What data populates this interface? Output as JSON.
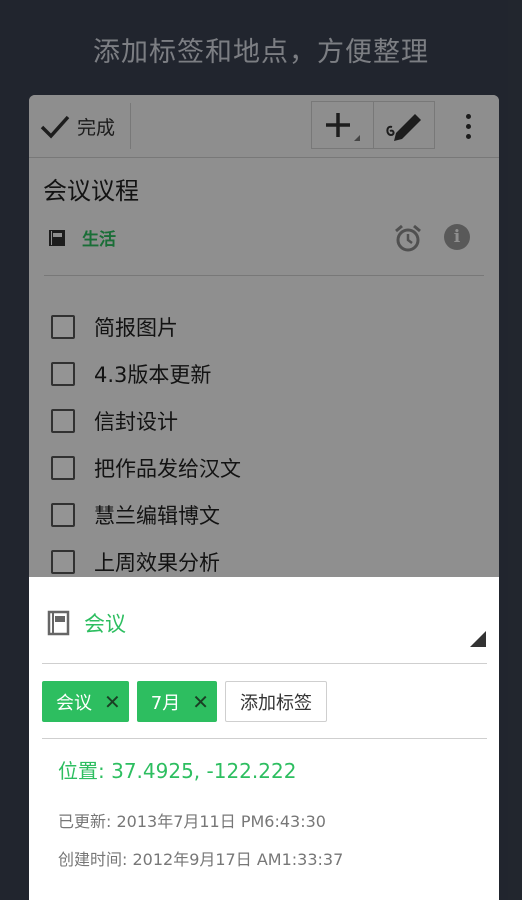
{
  "headline": "添加标签和地点，方便整理",
  "toolbar": {
    "done_label": "完成",
    "add_icon": "plus-icon",
    "pen_icon": "handwriting-pen-icon",
    "menu_icon": "more-vertical-icon"
  },
  "note": {
    "title": "会议议程",
    "notebook": "生活",
    "checklist": [
      "简报图片",
      "4.3版本更新",
      "信封设计",
      "把作品发给汉文",
      "慧兰编辑博文",
      "上周效果分析"
    ]
  },
  "sheet": {
    "notebook": "会议",
    "tags": [
      "会议",
      "7月"
    ],
    "add_tag_label": "添加标签",
    "location": "位置: 37.4925, -122.222",
    "updated": "已更新: 2013年7月11日 PM6:43:30",
    "created": "创建时间: 2012年9月17日 AM1:33:37"
  },
  "colors": {
    "accent": "#2dbe60",
    "background": "#3a4150"
  }
}
